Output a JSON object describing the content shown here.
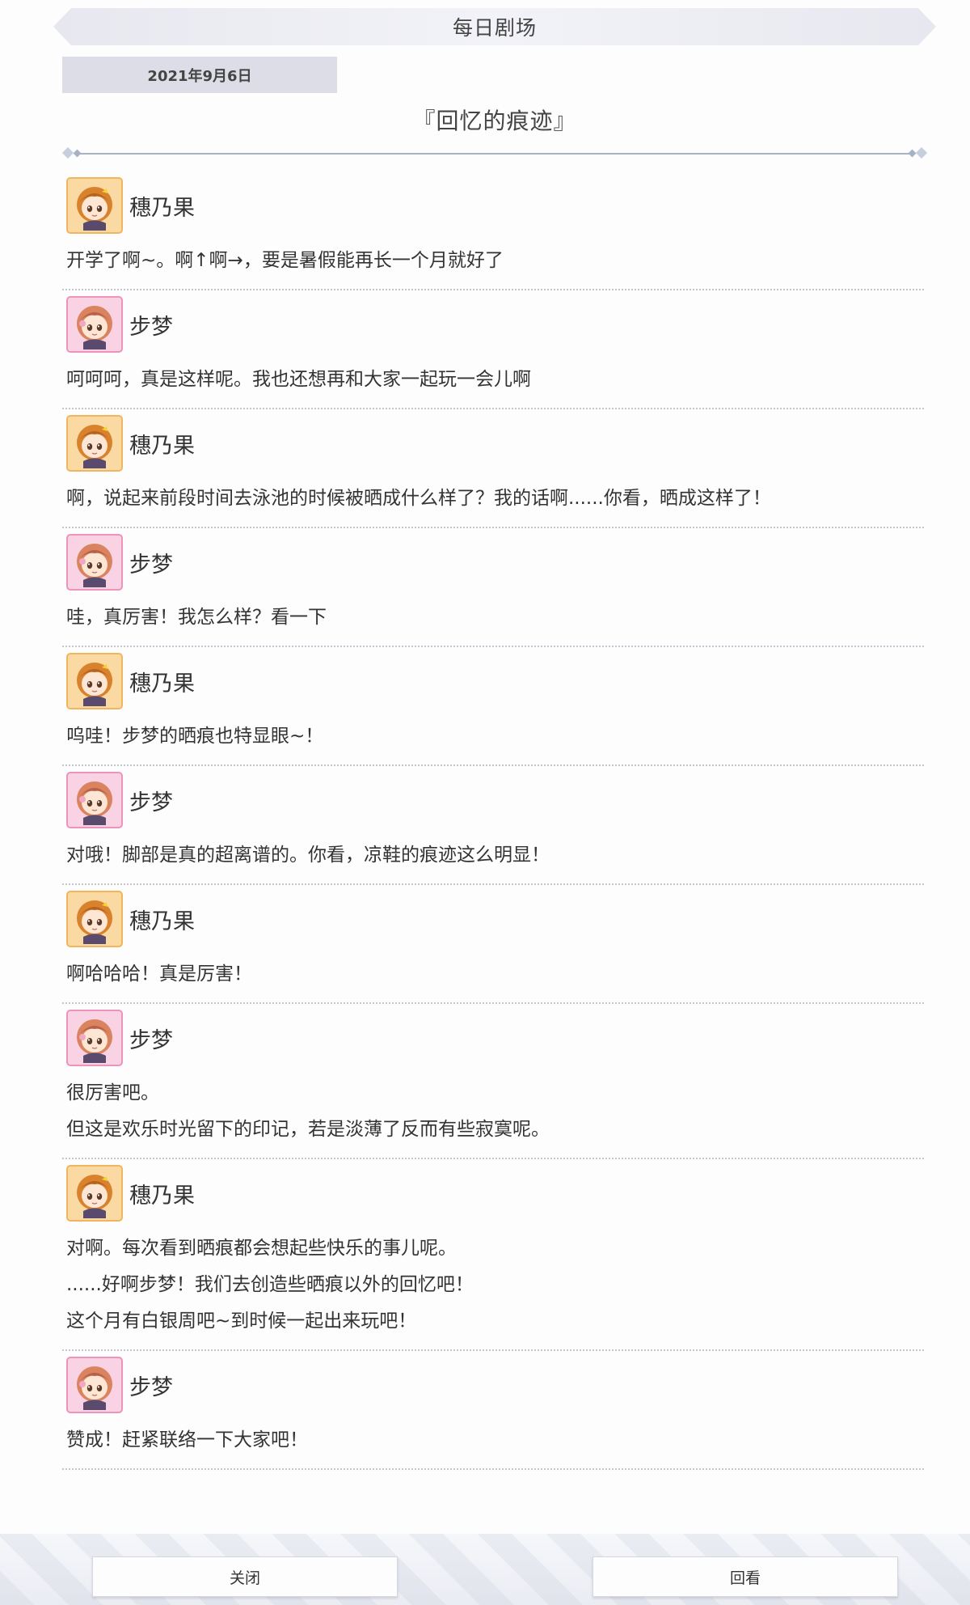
{
  "header": {
    "title": "每日剧场"
  },
  "story": {
    "date": "2021年9月6日",
    "title": "『回忆的痕迹』"
  },
  "characters": {
    "honoka": {
      "name": "穗乃果",
      "avatar_icon": "honoka-avatar-icon",
      "frame_color": "#f1b560"
    },
    "ayumu": {
      "name": "步梦",
      "avatar_icon": "ayumu-avatar-icon",
      "frame_color": "#ee93bb"
    }
  },
  "messages": [
    {
      "speaker": "穗乃果",
      "lines": [
        "开学了啊~。啊↑啊→，要是暑假能再长一个月就好了"
      ]
    },
    {
      "speaker": "步梦",
      "lines": [
        "呵呵呵，真是这样呢。我也还想再和大家一起玩一会儿啊"
      ]
    },
    {
      "speaker": "穗乃果",
      "lines": [
        "啊，说起来前段时间去泳池的时候被晒成什么样了？我的话啊......你看，晒成这样了！"
      ]
    },
    {
      "speaker": "步梦",
      "lines": [
        "哇，真厉害！我怎么样？看一下"
      ]
    },
    {
      "speaker": "穗乃果",
      "lines": [
        "呜哇！步梦的晒痕也特显眼~！"
      ]
    },
    {
      "speaker": "步梦",
      "lines": [
        "对哦！脚部是真的超离谱的。你看，凉鞋的痕迹这么明显！"
      ]
    },
    {
      "speaker": "穗乃果",
      "lines": [
        "啊哈哈哈！真是厉害！"
      ]
    },
    {
      "speaker": "步梦",
      "lines": [
        "很厉害吧。",
        "但这是欢乐时光留下的印记，若是淡薄了反而有些寂寞呢。"
      ]
    },
    {
      "speaker": "穗乃果",
      "lines": [
        "对啊。每次看到晒痕都会想起些快乐的事儿呢。",
        "......好啊步梦！我们去创造些晒痕以外的回忆吧！",
        "这个月有白银周吧~到时候一起出来玩吧！"
      ]
    },
    {
      "speaker": "步梦",
      "lines": [
        "赞成！赶紧联络一下大家吧！"
      ]
    }
  ],
  "buttons": {
    "close": "关闭",
    "review": "回看"
  }
}
